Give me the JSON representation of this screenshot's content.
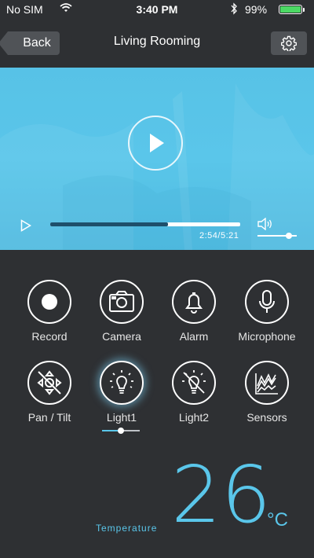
{
  "status_bar": {
    "carrier": "No SIM",
    "time": "3:40 PM",
    "battery_percent": "99%",
    "battery_level": 0.99
  },
  "nav": {
    "back_label": "Back",
    "title": "Living Rooming",
    "settings_icon": "gear-icon"
  },
  "player": {
    "time_readout": "2:54/5:21",
    "progress_fraction": 0.62,
    "volume_fraction": 0.8
  },
  "controls": [
    {
      "label": "Record",
      "icon": "record-icon"
    },
    {
      "label": "Camera",
      "icon": "camera-icon"
    },
    {
      "label": "Alarm",
      "icon": "bell-icon"
    },
    {
      "label": "Microphone",
      "icon": "microphone-icon"
    },
    {
      "label": "Pan / Tilt",
      "icon": "pan-tilt-disabled-icon"
    },
    {
      "label": "Light1",
      "icon": "light-bulb-icon",
      "active": true,
      "level": 0.5
    },
    {
      "label": "Light2",
      "icon": "light-bulb-disabled-icon"
    },
    {
      "label": "Sensors",
      "icon": "sensor-graph-icon"
    }
  ],
  "temperature": {
    "label": "Temperature",
    "value": "26",
    "unit": "°C"
  },
  "colors": {
    "accent": "#5ac6ea",
    "background": "#2e3033",
    "button": "#505357",
    "progress_played": "#1e4f6b",
    "battery": "#4cd964"
  }
}
